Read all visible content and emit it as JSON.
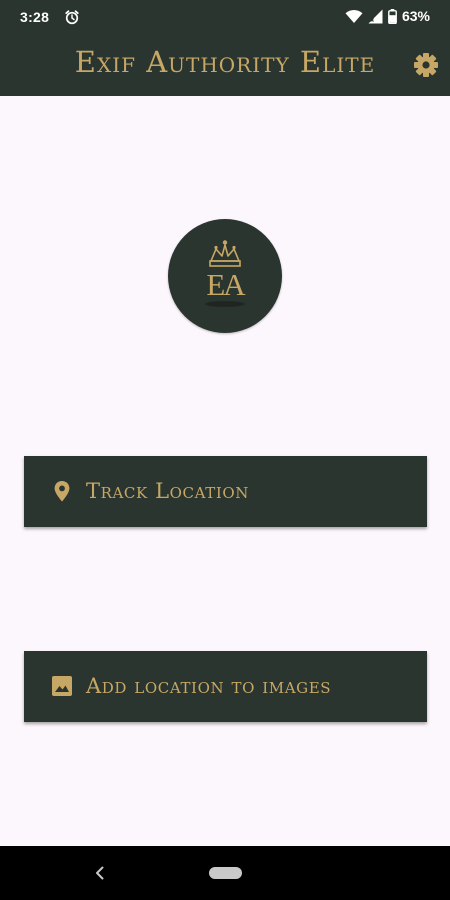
{
  "status_bar": {
    "time": "3:28",
    "battery_percent": "63%",
    "icons": [
      "alarm-icon",
      "wifi-icon",
      "signal-icon",
      "battery-icon"
    ]
  },
  "app_bar": {
    "title": "Exif Authority Elite",
    "settings_icon": "gear-icon"
  },
  "logo": {
    "text": "EA",
    "icon": "crown-icon"
  },
  "actions": [
    {
      "label": "Track Location",
      "icon": "location-pin-icon"
    },
    {
      "label": "Add location to images",
      "icon": "image-icon"
    }
  ],
  "nav_bar": {
    "icons": [
      "back-icon",
      "home-pill"
    ]
  },
  "colors": {
    "primary_dark": "#2b352f",
    "gold_accent": "#c7a766",
    "background": "#fcf7fc",
    "nav_bar": "#000000"
  }
}
